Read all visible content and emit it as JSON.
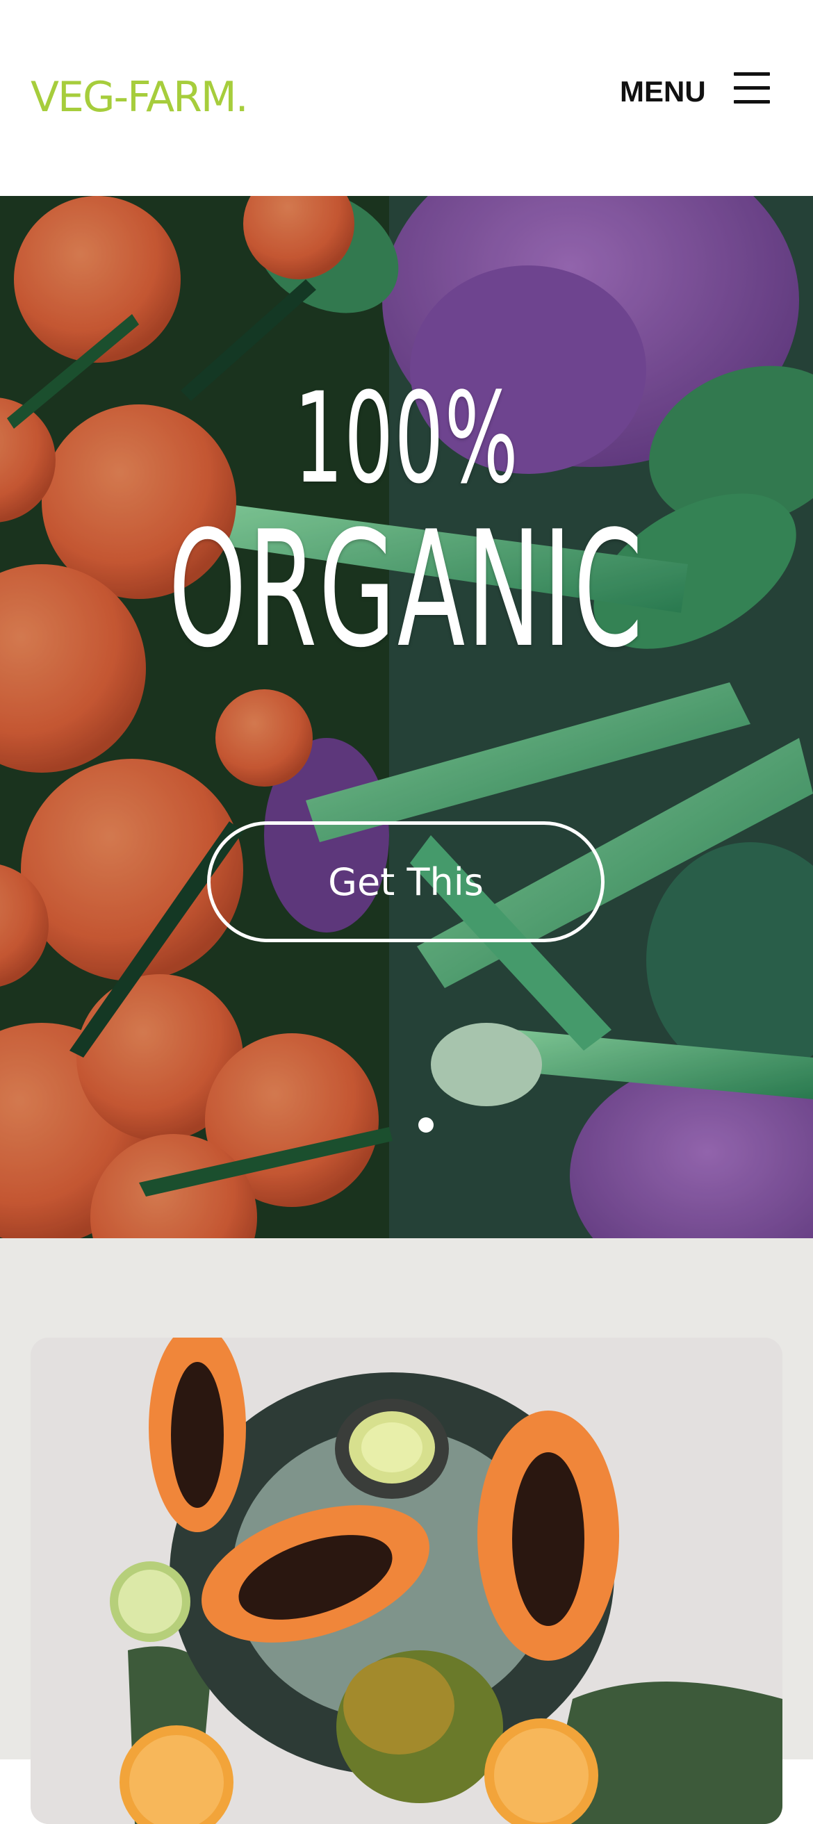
{
  "header": {
    "brand": "VEG-FARM.",
    "menu_label": "MENU",
    "brand_color": "#a6cd3c"
  },
  "hero": {
    "line1": "100%",
    "line2": "ORGANIC",
    "cta_label": "Get This",
    "slides_total": 1,
    "slide_active": 1
  },
  "icons": {
    "menu": "hamburger-icon"
  }
}
